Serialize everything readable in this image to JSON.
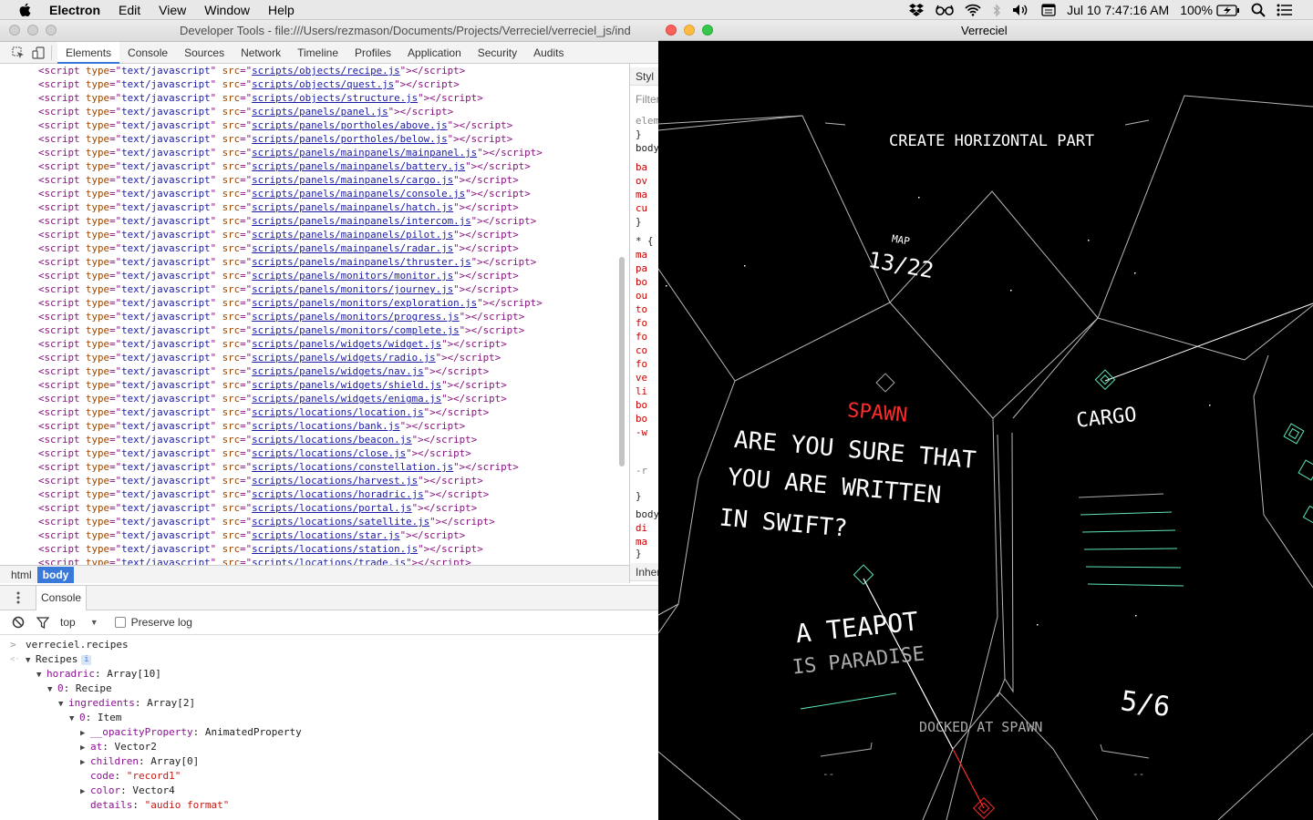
{
  "menubar": {
    "app_name": "Electron",
    "items": [
      "Edit",
      "View",
      "Window",
      "Help"
    ],
    "clock": "Jul 10  7:47:16 AM",
    "battery": "100%"
  },
  "devtools": {
    "title": "Developer Tools - file:///Users/rezmason/Documents/Projects/Verreciel/verreciel_js/ind",
    "tabs": [
      "Elements",
      "Console",
      "Sources",
      "Network",
      "Timeline",
      "Profiles",
      "Application",
      "Security",
      "Audits"
    ],
    "active_tab": "Elements",
    "script_tag": "script",
    "script_type_attr": "type",
    "script_type_value": "text/javascript",
    "script_src_attr": "src",
    "scripts": [
      "scripts/objects/recipe.js",
      "scripts/objects/quest.js",
      "scripts/objects/structure.js",
      "scripts/panels/panel.js",
      "scripts/panels/portholes/above.js",
      "scripts/panels/portholes/below.js",
      "scripts/panels/mainpanels/mainpanel.js",
      "scripts/panels/mainpanels/battery.js",
      "scripts/panels/mainpanels/cargo.js",
      "scripts/panels/mainpanels/console.js",
      "scripts/panels/mainpanels/hatch.js",
      "scripts/panels/mainpanels/intercom.js",
      "scripts/panels/mainpanels/pilot.js",
      "scripts/panels/mainpanels/radar.js",
      "scripts/panels/mainpanels/thruster.js",
      "scripts/panels/monitors/monitor.js",
      "scripts/panels/monitors/journey.js",
      "scripts/panels/monitors/exploration.js",
      "scripts/panels/monitors/progress.js",
      "scripts/panels/monitors/complete.js",
      "scripts/panels/widgets/widget.js",
      "scripts/panels/widgets/radio.js",
      "scripts/panels/widgets/nav.js",
      "scripts/panels/widgets/shield.js",
      "scripts/panels/widgets/enigma.js",
      "scripts/locations/location.js",
      "scripts/locations/bank.js",
      "scripts/locations/beacon.js",
      "scripts/locations/close.js",
      "scripts/locations/constellation.js",
      "scripts/locations/harvest.js",
      "scripts/locations/horadric.js",
      "scripts/locations/portal.js",
      "scripts/locations/satellite.js",
      "scripts/locations/star.js",
      "scripts/locations/station.js",
      "scripts/locations/trade.js"
    ],
    "breadcrumbs": [
      "html",
      "body"
    ],
    "styles_pane": {
      "tab": "Styl",
      "filter_placeholder": "Filter",
      "inherited_label": "Inher",
      "lines": [
        {
          "t": "elem",
          "c": "grey"
        },
        {
          "t": "}",
          "c": ""
        },
        {
          "t": "body",
          "c": ""
        },
        {
          "t": "ba",
          "c": "red"
        },
        {
          "t": "ov",
          "c": "red"
        },
        {
          "t": "ma",
          "c": "red"
        },
        {
          "t": "cu",
          "c": "red"
        },
        {
          "t": "}",
          "c": ""
        },
        {
          "t": "* {",
          "c": ""
        },
        {
          "t": "ma",
          "c": "red"
        },
        {
          "t": "pa",
          "c": "red"
        },
        {
          "t": "bo",
          "c": "red"
        },
        {
          "t": "ou",
          "c": "red"
        },
        {
          "t": "to",
          "c": "red"
        },
        {
          "t": "fo",
          "c": "red"
        },
        {
          "t": "fo",
          "c": "red"
        },
        {
          "t": "co",
          "c": "red"
        },
        {
          "t": "fo",
          "c": "red"
        },
        {
          "t": "ve",
          "c": "red"
        },
        {
          "t": "li",
          "c": "red"
        },
        {
          "t": "bo",
          "c": "red"
        },
        {
          "t": "bo",
          "c": "red"
        },
        {
          "t": "-w",
          "c": "red"
        }
      ],
      "dash": "-r",
      "close": "}",
      "body2": "body",
      "body2_lines": [
        "di",
        "ma"
      ],
      "close2": "}",
      "star": "* {",
      "star_line": "ma"
    },
    "drawer": {
      "tab": "Console",
      "context": "top",
      "preserve_log": "Preserve log",
      "input": "verreciel.recipes",
      "tree": [
        {
          "indent": 0,
          "tri": "▼",
          "key": "Recipes",
          "badge": "i"
        },
        {
          "indent": 1,
          "tri": "▼",
          "key": "horadric",
          "val": "Array[10]"
        },
        {
          "indent": 2,
          "tri": "▼",
          "key": "0",
          "val": "Recipe"
        },
        {
          "indent": 3,
          "tri": "▼",
          "key": "ingredients",
          "val": "Array[2]"
        },
        {
          "indent": 4,
          "tri": "▼",
          "key": "0",
          "val": "Item"
        },
        {
          "indent": 5,
          "tri": "▶",
          "key": "__opacityProperty",
          "val": "AnimatedProperty"
        },
        {
          "indent": 5,
          "tri": "▶",
          "key": "at",
          "val": "Vector2"
        },
        {
          "indent": 5,
          "tri": "▶",
          "key": "children",
          "val": "Array[0]"
        },
        {
          "indent": 5,
          "tri": "",
          "key": "code",
          "str": "\"record1\""
        },
        {
          "indent": 5,
          "tri": "▶",
          "key": "color",
          "val": "Vector4"
        },
        {
          "indent": 5,
          "tri": "",
          "key": "details",
          "str": "\"audio format\""
        }
      ]
    }
  },
  "game": {
    "title": "Verreciel",
    "hud_top": "CREATE HORIZONTAL PART",
    "map_label": "MAP",
    "map_value": "13/22",
    "spawn_label": "SPAWN",
    "dialog_lines": [
      "ARE YOU SURE THAT",
      "YOU ARE WRITTEN",
      "IN SWIFT?"
    ],
    "cargo_label": "CARGO",
    "teapot_title": "A TEAPOT",
    "teapot_sub": "IS PARADISE",
    "docked": "DOCKED AT SPAWN",
    "counter": "5/6",
    "dash_left": "--",
    "dash_right": "--",
    "colors": {
      "spawn": "#ff2a2a",
      "accent": "#5de6b4",
      "line": "#b8b8b8"
    }
  }
}
